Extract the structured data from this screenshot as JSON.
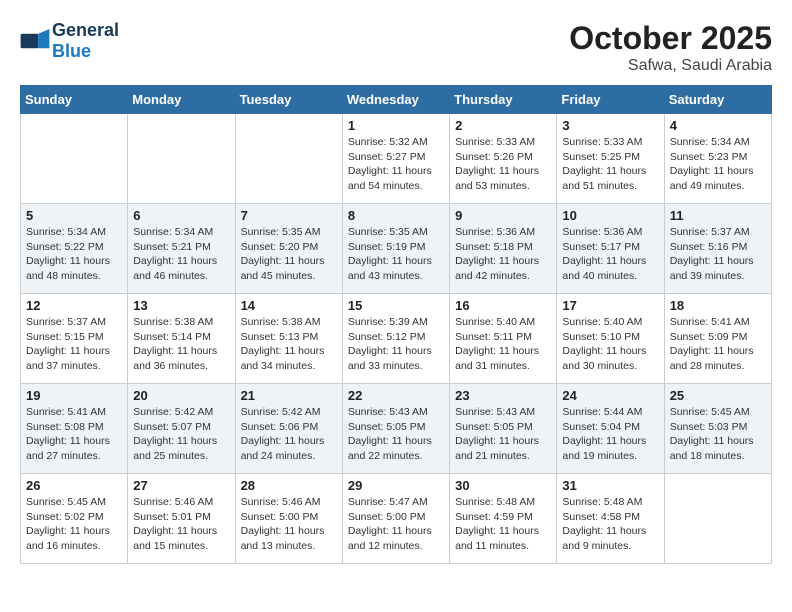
{
  "logo": {
    "general": "General",
    "blue": "Blue"
  },
  "title": "October 2025",
  "subtitle": "Safwa, Saudi Arabia",
  "headers": [
    "Sunday",
    "Monday",
    "Tuesday",
    "Wednesday",
    "Thursday",
    "Friday",
    "Saturday"
  ],
  "weeks": [
    [
      {
        "day": "",
        "info": ""
      },
      {
        "day": "",
        "info": ""
      },
      {
        "day": "",
        "info": ""
      },
      {
        "day": "1",
        "info": "Sunrise: 5:32 AM\nSunset: 5:27 PM\nDaylight: 11 hours\nand 54 minutes."
      },
      {
        "day": "2",
        "info": "Sunrise: 5:33 AM\nSunset: 5:26 PM\nDaylight: 11 hours\nand 53 minutes."
      },
      {
        "day": "3",
        "info": "Sunrise: 5:33 AM\nSunset: 5:25 PM\nDaylight: 11 hours\nand 51 minutes."
      },
      {
        "day": "4",
        "info": "Sunrise: 5:34 AM\nSunset: 5:23 PM\nDaylight: 11 hours\nand 49 minutes."
      }
    ],
    [
      {
        "day": "5",
        "info": "Sunrise: 5:34 AM\nSunset: 5:22 PM\nDaylight: 11 hours\nand 48 minutes."
      },
      {
        "day": "6",
        "info": "Sunrise: 5:34 AM\nSunset: 5:21 PM\nDaylight: 11 hours\nand 46 minutes."
      },
      {
        "day": "7",
        "info": "Sunrise: 5:35 AM\nSunset: 5:20 PM\nDaylight: 11 hours\nand 45 minutes."
      },
      {
        "day": "8",
        "info": "Sunrise: 5:35 AM\nSunset: 5:19 PM\nDaylight: 11 hours\nand 43 minutes."
      },
      {
        "day": "9",
        "info": "Sunrise: 5:36 AM\nSunset: 5:18 PM\nDaylight: 11 hours\nand 42 minutes."
      },
      {
        "day": "10",
        "info": "Sunrise: 5:36 AM\nSunset: 5:17 PM\nDaylight: 11 hours\nand 40 minutes."
      },
      {
        "day": "11",
        "info": "Sunrise: 5:37 AM\nSunset: 5:16 PM\nDaylight: 11 hours\nand 39 minutes."
      }
    ],
    [
      {
        "day": "12",
        "info": "Sunrise: 5:37 AM\nSunset: 5:15 PM\nDaylight: 11 hours\nand 37 minutes."
      },
      {
        "day": "13",
        "info": "Sunrise: 5:38 AM\nSunset: 5:14 PM\nDaylight: 11 hours\nand 36 minutes."
      },
      {
        "day": "14",
        "info": "Sunrise: 5:38 AM\nSunset: 5:13 PM\nDaylight: 11 hours\nand 34 minutes."
      },
      {
        "day": "15",
        "info": "Sunrise: 5:39 AM\nSunset: 5:12 PM\nDaylight: 11 hours\nand 33 minutes."
      },
      {
        "day": "16",
        "info": "Sunrise: 5:40 AM\nSunset: 5:11 PM\nDaylight: 11 hours\nand 31 minutes."
      },
      {
        "day": "17",
        "info": "Sunrise: 5:40 AM\nSunset: 5:10 PM\nDaylight: 11 hours\nand 30 minutes."
      },
      {
        "day": "18",
        "info": "Sunrise: 5:41 AM\nSunset: 5:09 PM\nDaylight: 11 hours\nand 28 minutes."
      }
    ],
    [
      {
        "day": "19",
        "info": "Sunrise: 5:41 AM\nSunset: 5:08 PM\nDaylight: 11 hours\nand 27 minutes."
      },
      {
        "day": "20",
        "info": "Sunrise: 5:42 AM\nSunset: 5:07 PM\nDaylight: 11 hours\nand 25 minutes."
      },
      {
        "day": "21",
        "info": "Sunrise: 5:42 AM\nSunset: 5:06 PM\nDaylight: 11 hours\nand 24 minutes."
      },
      {
        "day": "22",
        "info": "Sunrise: 5:43 AM\nSunset: 5:05 PM\nDaylight: 11 hours\nand 22 minutes."
      },
      {
        "day": "23",
        "info": "Sunrise: 5:43 AM\nSunset: 5:05 PM\nDaylight: 11 hours\nand 21 minutes."
      },
      {
        "day": "24",
        "info": "Sunrise: 5:44 AM\nSunset: 5:04 PM\nDaylight: 11 hours\nand 19 minutes."
      },
      {
        "day": "25",
        "info": "Sunrise: 5:45 AM\nSunset: 5:03 PM\nDaylight: 11 hours\nand 18 minutes."
      }
    ],
    [
      {
        "day": "26",
        "info": "Sunrise: 5:45 AM\nSunset: 5:02 PM\nDaylight: 11 hours\nand 16 minutes."
      },
      {
        "day": "27",
        "info": "Sunrise: 5:46 AM\nSunset: 5:01 PM\nDaylight: 11 hours\nand 15 minutes."
      },
      {
        "day": "28",
        "info": "Sunrise: 5:46 AM\nSunset: 5:00 PM\nDaylight: 11 hours\nand 13 minutes."
      },
      {
        "day": "29",
        "info": "Sunrise: 5:47 AM\nSunset: 5:00 PM\nDaylight: 11 hours\nand 12 minutes."
      },
      {
        "day": "30",
        "info": "Sunrise: 5:48 AM\nSunset: 4:59 PM\nDaylight: 11 hours\nand 11 minutes."
      },
      {
        "day": "31",
        "info": "Sunrise: 5:48 AM\nSunset: 4:58 PM\nDaylight: 11 hours\nand 9 minutes."
      },
      {
        "day": "",
        "info": ""
      }
    ]
  ]
}
